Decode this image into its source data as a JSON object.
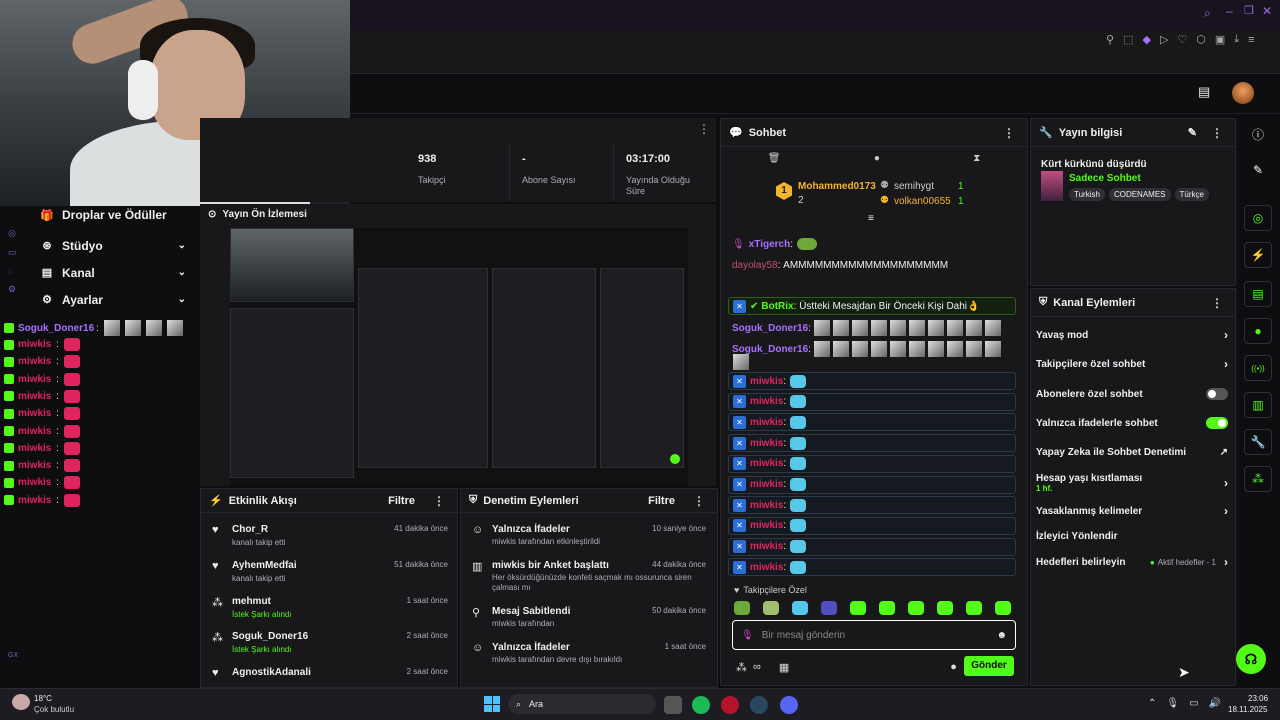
{
  "webcam": {
    "label": "streamer-webcam"
  },
  "channel_stats": [
    {
      "value": "938",
      "label": "Takipçi"
    },
    {
      "value": "-",
      "label": "Abone Sayısı"
    },
    {
      "value": "03:17:00",
      "label": "Yayında Olduğu Süre"
    }
  ],
  "sidebar": {
    "items": [
      {
        "label": "Droplar ve Ödüller"
      },
      {
        "label": "Stüdyo"
      },
      {
        "label": "Kanal"
      },
      {
        "label": "Ayarlar"
      }
    ],
    "footer": "GX"
  },
  "left_chat": {
    "first_user": "Soguk_Doner16",
    "repeat_user": "miwkis",
    "repeat_count": 10
  },
  "preview": {
    "title": "Yayın Ön İzlemesi"
  },
  "activity": {
    "title": "Etkinlik Akışı",
    "filter": "Filtre",
    "items": [
      {
        "name": "Chor_R",
        "sub": "kanalı takip etti",
        "time": "41 dakika önce",
        "icon": "heart-icon"
      },
      {
        "name": "AyhemMedfai",
        "sub": "kanalı takip etti",
        "time": "51 dakika önce",
        "icon": "heart-icon"
      },
      {
        "name": "mehmut",
        "sub": "İstek Şarkı alındı",
        "time": "1 saat önce",
        "icon": "points-icon"
      },
      {
        "name": "Soguk_Doner16",
        "sub": "İstek Şarkı alındı",
        "time": "2 saat önce",
        "icon": "points-icon"
      },
      {
        "name": "AgnostikAdanali",
        "sub": "",
        "time": "2 saat önce",
        "icon": "heart-icon"
      }
    ]
  },
  "moderation": {
    "title": "Denetim Eylemleri",
    "filter": "Filtre",
    "items": [
      {
        "name": "Yalnızca İfadeler",
        "sub": "miwkis tarafından etkinleştirildi",
        "time": "10 saniye önce"
      },
      {
        "name": "miwkis bir Anket başlattı",
        "sub": "Her öksürdüğünüzde konfeti saçmak mı ossurunca siren çalması mı",
        "time": "44 dakika önce"
      },
      {
        "name": "Mesaj Sabitlendi",
        "sub": "miwkis tarafından",
        "time": "50 dakika önce"
      },
      {
        "name": "Yalnızca İfadeler",
        "sub": "miwkis tarafından devre dışı bırakıldı",
        "time": "1 saat önce"
      }
    ]
  },
  "chat": {
    "title": "Sohbet",
    "leaderboard": [
      {
        "rank": "1",
        "name": "Mohammed0173",
        "count": "2"
      },
      {
        "name": "semihygt",
        "count": "1"
      },
      {
        "name": "volkan00655",
        "count": "1"
      }
    ],
    "messages": [
      {
        "user": "xTigerch",
        "text": ""
      },
      {
        "user": "dayolay58",
        "text": "AMMMMMMMMMMMMMMMMMMM"
      },
      {
        "user": "BotRix",
        "text": "Üstteki Mesajdan Bir Önceki Kişi Dahi👌"
      },
      {
        "user": "Soguk_Doner16",
        "text": ""
      },
      {
        "user": "Soguk_Doner16",
        "text": ""
      }
    ],
    "miwkis_user": "miwkis",
    "followers_only": "Takipçilere Özel",
    "input_placeholder": "Bir mesaj gönderin",
    "send": "Gönder"
  },
  "stream_info": {
    "title": "Yayın bilgisi",
    "stream_title": "Kürt kürkünü düşürdü",
    "category": "Sadece Sohbet",
    "tags": [
      "Turkish",
      "CODENAMES",
      "Türkçe"
    ]
  },
  "channel_actions": {
    "title": "Kanal Eylemleri",
    "items": [
      {
        "label": "Yavaş mod",
        "control": "chevron"
      },
      {
        "label": "Takipçilere özel sohbet",
        "control": "chevron"
      },
      {
        "label": "Abonelere özel sohbet",
        "control": "toggle-off"
      },
      {
        "label": "Yalnızca ifadelerle sohbet",
        "control": "toggle-on"
      },
      {
        "label": "Yapay Zeka ile Sohbet Denetimi",
        "control": "external"
      },
      {
        "label": "Hesap yaşı kısıtlaması",
        "sub": "1 hf.",
        "control": "chevron"
      },
      {
        "label": "Yasaklanmış kelimeler",
        "control": "chevron"
      },
      {
        "label": "İzleyici Yönlendir",
        "control": "none"
      },
      {
        "label": "Hedefleri belirleyin",
        "extra": "Aktif hedefler - 1",
        "control": "chevron"
      }
    ]
  },
  "taskbar": {
    "weather_temp": "18°C",
    "weather_desc": "Çok bulutlu",
    "search": "Ara",
    "time": "23:06",
    "date": "18.11.2025"
  },
  "colors": {
    "accent": "#53fc18",
    "bg": "#0e0e10",
    "panel": "#18181b",
    "pink": "#e0245e",
    "purple": "#a970ff"
  }
}
